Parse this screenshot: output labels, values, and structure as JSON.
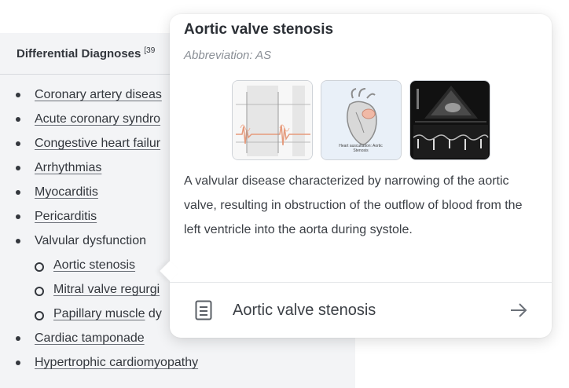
{
  "panel": {
    "title": "Differential Diagnoses",
    "ref": "[39",
    "items": [
      {
        "text": "Coronary artery diseas",
        "level": 1,
        "link": true
      },
      {
        "text": "Acute coronary syndro",
        "level": 1,
        "link": true
      },
      {
        "text": "Congestive heart failur",
        "level": 1,
        "link": true
      },
      {
        "text": "Arrhythmias",
        "level": 1,
        "link": true
      },
      {
        "text": "Myocarditis",
        "level": 1,
        "link": true
      },
      {
        "text": "Pericarditis",
        "level": 1,
        "link": true
      },
      {
        "text": "Valvular dysfunction",
        "level": 1,
        "link": false
      },
      {
        "text": "Aortic stenosis",
        "level": 2,
        "link": true
      },
      {
        "text": "Mitral valve regurgi",
        "level": 2,
        "link": true
      },
      {
        "text": "Papillary muscle",
        "rest": " dy",
        "level": 2,
        "link": true
      },
      {
        "text": "Cardiac tamponade",
        "level": 1,
        "link": true
      },
      {
        "text": "Hypertrophic cardiomyopathy",
        "level": 1,
        "link": true
      }
    ]
  },
  "popover": {
    "title": "Aortic valve stenosis",
    "abbreviation": "Abbreviation: AS",
    "thumb2_caption": "Heart auscultation: Aortic Stenosis",
    "description": "A valvular disease characterized by narrowing of the aortic valve, resulting in obstruction of the outflow of blood from the left ventricle into the aorta during systole.",
    "footer_label": "Aortic valve stenosis"
  },
  "colors": {
    "panel_bg": "#f3f4f6",
    "text": "#33373d",
    "muted": "#8a8f96"
  },
  "icons": [
    "document-icon",
    "arrow-right-icon"
  ]
}
